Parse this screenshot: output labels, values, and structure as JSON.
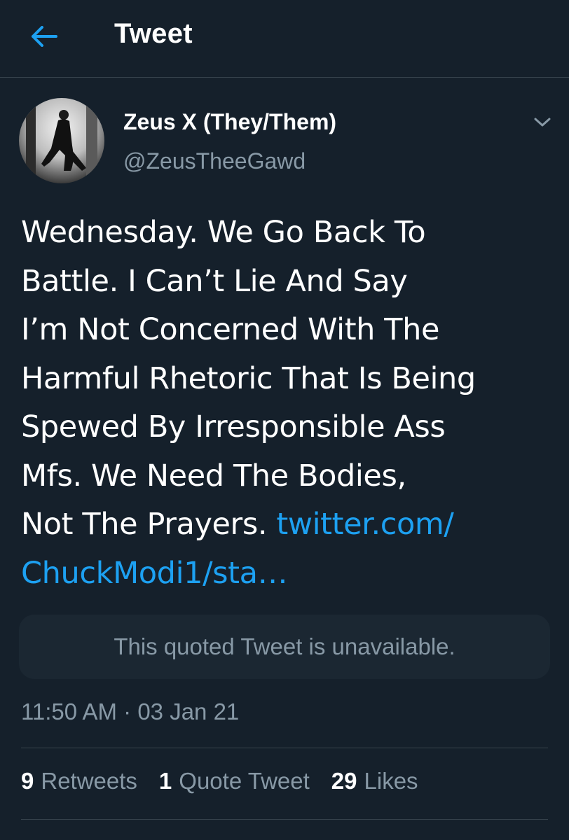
{
  "header": {
    "title": "Tweet"
  },
  "tweet": {
    "author_name": "Zeus X (They/Them)",
    "author_handle": "@ZeusTheeGawd",
    "text": "Wednesday. We Go Back To\nBattle. I Can’t Lie And Say\nI’m Not Concerned With The\nHarmful Rhetoric That Is Being\nSpewed By Irresponsible Ass\nMfs. We Need The Bodies,\nNot The Prayers. ",
    "link_text": "twitter.com/\nChuckModi1/sta…",
    "quoted_unavailable": "This quoted Tweet is unavailable.",
    "time": "11:50 AM",
    "separator": "·",
    "date": "03 Jan 21"
  },
  "stats": {
    "retweets_count": "9",
    "retweets_label": "Retweets",
    "quotes_count": "1",
    "quotes_label": "Quote Tweet",
    "likes_count": "29",
    "likes_label": "Likes"
  },
  "icons": {
    "back": "back-arrow-icon",
    "caret": "chevron-down-icon"
  },
  "colors": {
    "background": "#15202b",
    "accent": "#1da1f2",
    "secondary_text": "#8899a6",
    "border": "#38444d",
    "quote_bg": "#1b2732"
  }
}
